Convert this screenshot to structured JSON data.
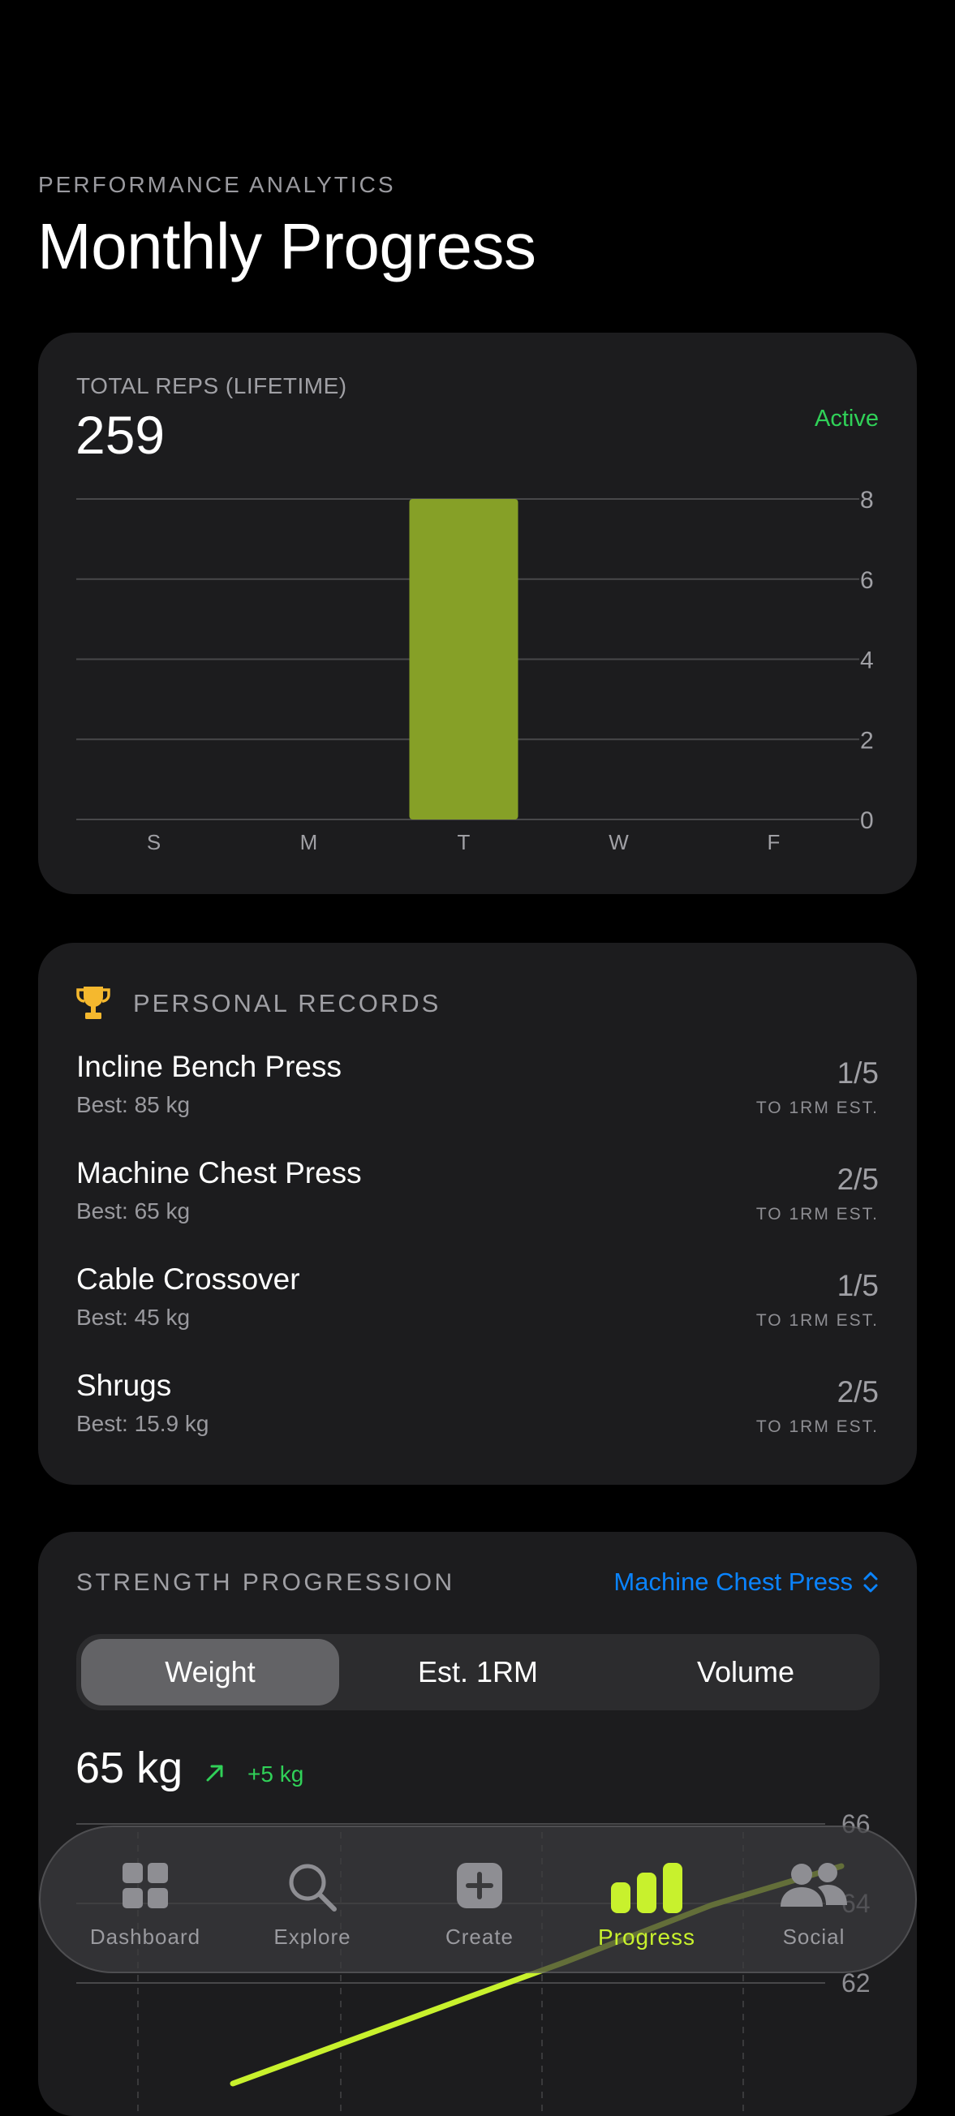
{
  "header": {
    "eyebrow": "PERFORMANCE ANALYTICS",
    "title": "Monthly Progress"
  },
  "reps_card": {
    "label": "TOTAL REPS (LIFETIME)",
    "value": "259",
    "status": "Active",
    "status_color": "#30d158"
  },
  "chart_data": [
    {
      "type": "bar",
      "categories": [
        "S",
        "M",
        "T",
        "W",
        "F"
      ],
      "values": [
        0,
        0,
        8,
        0,
        0
      ],
      "yticks": [
        0,
        2,
        4,
        6,
        8
      ],
      "ylim": [
        0,
        8
      ],
      "grid": true,
      "bar_color": "#86a027"
    },
    {
      "type": "line",
      "yticks_visible": [
        66,
        64,
        62
      ],
      "current_value": "65 kg",
      "line_color": "#c8f12d",
      "grid": true
    }
  ],
  "records": {
    "title": "PERSONAL RECORDS",
    "icon": "trophy-icon",
    "items": [
      {
        "name": "Incline Bench Press",
        "best": "Best: 85 kg",
        "fraction": "1/5",
        "note": "TO 1RM EST."
      },
      {
        "name": "Machine Chest Press",
        "best": "Best: 65 kg",
        "fraction": "2/5",
        "note": "TO 1RM EST."
      },
      {
        "name": "Cable Crossover",
        "best": "Best: 45 kg",
        "fraction": "1/5",
        "note": "TO 1RM EST."
      },
      {
        "name": "Shrugs",
        "best": "Best: 15.9 kg",
        "fraction": "2/5",
        "note": "TO 1RM EST."
      }
    ]
  },
  "strength": {
    "title": "STRENGTH PROGRESSION",
    "exercise": "Machine Chest Press",
    "segments": [
      "Weight",
      "Est. 1RM",
      "Volume"
    ],
    "active_segment": "Weight",
    "value": "65 kg",
    "delta": "+5 kg"
  },
  "tabbar": {
    "tabs": [
      {
        "label": "Dashboard",
        "icon": "grid-icon"
      },
      {
        "label": "Explore",
        "icon": "search-icon"
      },
      {
        "label": "Create",
        "icon": "plus-square-icon"
      },
      {
        "label": "Progress",
        "icon": "bar-chart-icon"
      },
      {
        "label": "Social",
        "icon": "people-icon"
      }
    ],
    "active": "Progress",
    "active_color": "#c8f12d"
  }
}
